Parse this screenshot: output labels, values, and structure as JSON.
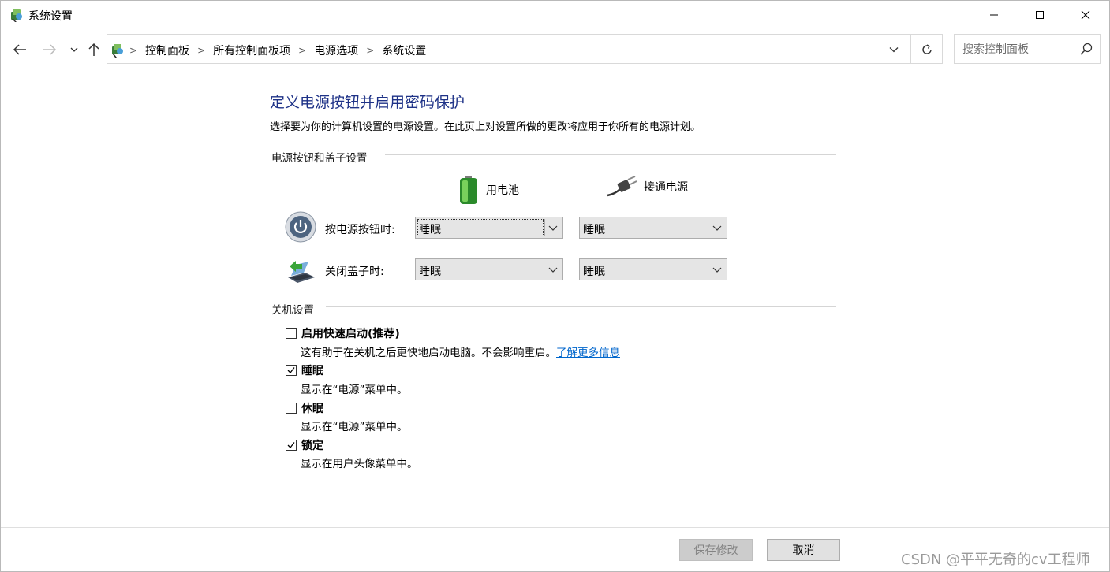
{
  "window": {
    "title": "系统设置"
  },
  "nav": {
    "breadcrumbs": [
      "控制面板",
      "所有控制面板项",
      "电源选项",
      "系统设置"
    ],
    "search_placeholder": "搜索控制面板"
  },
  "main": {
    "title": "定义电源按钮并启用密码保护",
    "description": "选择要为你的计算机设置的电源设置。在此页上对设置所做的更改将应用于你所有的电源计划。",
    "power_section": {
      "heading": "电源按钮和盖子设置",
      "col_battery": "用电池",
      "col_plugged": "接通电源",
      "rows": [
        {
          "label": "按电源按钮时:",
          "battery": "睡眠",
          "plugged": "睡眠"
        },
        {
          "label": "关闭盖子时:",
          "battery": "睡眠",
          "plugged": "睡眠"
        }
      ]
    },
    "shutdown_section": {
      "heading": "关机设置",
      "items": [
        {
          "label": "启用快速启动(推荐)",
          "checked": false,
          "desc": "这有助于在关机之后更快地启动电脑。不会影响重启。",
          "link": "了解更多信息"
        },
        {
          "label": "睡眠",
          "checked": true,
          "desc": "显示在“电源”菜单中。"
        },
        {
          "label": "休眠",
          "checked": false,
          "desc": "显示在“电源”菜单中。"
        },
        {
          "label": "锁定",
          "checked": true,
          "desc": "显示在用户头像菜单中。"
        }
      ]
    }
  },
  "footer": {
    "save_label": "保存修改",
    "cancel_label": "取消"
  },
  "watermark": "CSDN @平平无奇的cv工程师",
  "colors": {
    "title_blue": "#1e3287",
    "link_blue": "#0066cc"
  }
}
